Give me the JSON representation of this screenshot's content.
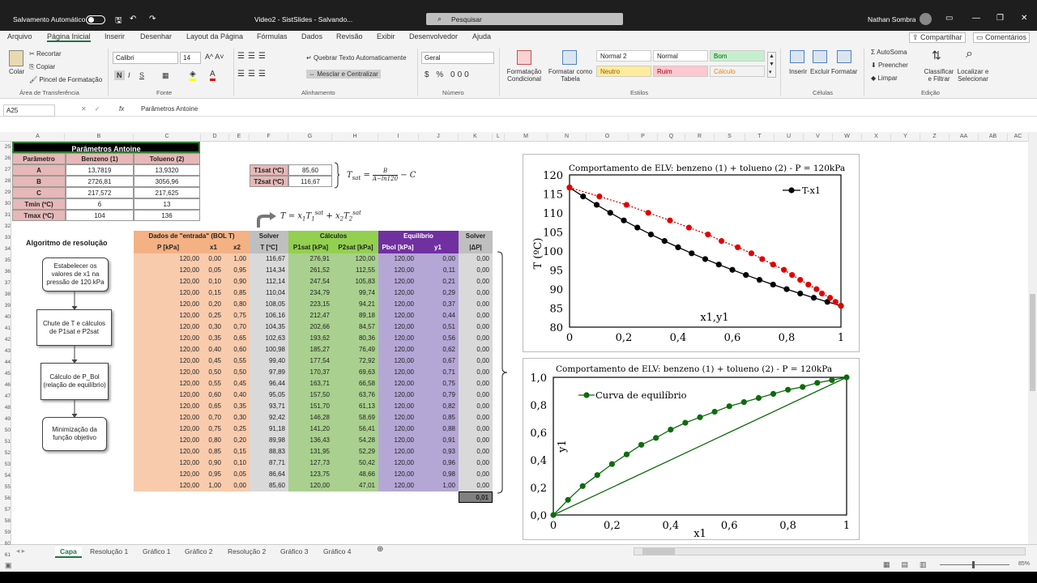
{
  "titlebar": {
    "autosave": "Salvamento Automático",
    "doc": "Video2 - SistSlides - Salvando...",
    "search": "Pesquisar",
    "user": "Nathan Sombra"
  },
  "menu": [
    "Arquivo",
    "Página Inicial",
    "Inserir",
    "Desenhar",
    "Layout da Página",
    "Fórmulas",
    "Dados",
    "Revisão",
    "Exibir",
    "Desenvolvedor",
    "Ajuda"
  ],
  "share": "Compartilhar",
  "comments": "Comentários",
  "ribbon": {
    "colar": "Colar",
    "recortar": "Recortar",
    "copiar": "Copiar",
    "pincel": "Pincel de Formatação",
    "area": "Área de Transferência",
    "font": "Calibri",
    "size": "14",
    "fonte": "Fonte",
    "wrap": "Quebrar Texto Automaticamente",
    "merge": "Mesclar e Centralizar",
    "alinhamento": "Alinhamento",
    "numfmt": "Geral",
    "numero": "Número",
    "cond": "Formatação Condicional",
    "tabela": "Formatar como Tabela",
    "estilos": "Estilos",
    "inserir": "Inserir",
    "excluir": "Excluir",
    "formatar": "Formatar",
    "celulas": "Células",
    "autosoma": "AutoSoma",
    "preencher": "Preencher",
    "limpar": "Limpar",
    "classificar": "Classificar e Filtrar",
    "localizar": "Localizar e Selecionar",
    "edicao": "Edição",
    "styles": [
      {
        "name": "Normal 2",
        "bg": "#ffffff",
        "fg": "#222222"
      },
      {
        "name": "Normal",
        "bg": "#ffffff",
        "fg": "#222222"
      },
      {
        "name": "Bom",
        "bg": "#c6efce",
        "fg": "#006100"
      },
      {
        "name": "Neutro",
        "bg": "#ffeb9c",
        "fg": "#9c5700"
      },
      {
        "name": "Ruim",
        "bg": "#ffc7ce",
        "fg": "#9c0006"
      },
      {
        "name": "Cálculo",
        "bg": "#f2f2f2",
        "fg": "#fa7d00"
      }
    ]
  },
  "formula": {
    "namebox": "A25",
    "fx": "fx",
    "content": "Parâmetros Antoine"
  },
  "columns": [
    "A",
    "B",
    "C",
    "D",
    "E",
    "F",
    "G",
    "H",
    "I",
    "J",
    "K",
    "L",
    "M",
    "N",
    "O",
    "P",
    "Q",
    "R",
    "S",
    "T",
    "U",
    "V",
    "W",
    "X",
    "Y",
    "Z",
    "AA",
    "AB",
    "AC"
  ],
  "rows": [
    "25",
    "26",
    "27",
    "28",
    "29",
    "30",
    "31",
    "32",
    "33",
    "34",
    "35",
    "36",
    "37",
    "38",
    "39",
    "40",
    "41",
    "42",
    "43",
    "44",
    "45",
    "46",
    "47",
    "48",
    "49",
    "50",
    "51",
    "52",
    "53",
    "54",
    "55",
    "56",
    "57",
    "58",
    "59",
    "60",
    "61"
  ],
  "antoine": {
    "title": "Parâmetros Antoine",
    "headers": [
      "Parâmetro",
      "Benzeno (1)",
      "Tolueno (2)"
    ],
    "rows": [
      [
        "A",
        "13,7819",
        "13,9320"
      ],
      [
        "B",
        "2726,81",
        "3056,96"
      ],
      [
        "C",
        "217,572",
        "217,625"
      ],
      [
        "Tmin (ºC)",
        "6",
        "13"
      ],
      [
        "Tmax (ºC)",
        "104",
        "136"
      ]
    ]
  },
  "tsat": {
    "rows": [
      [
        "T1sat (ºC)",
        "85,60"
      ],
      [
        "T2sat (ºC)",
        "116,67"
      ]
    ]
  },
  "algo": {
    "title": "Algoritmo de resolução",
    "steps": [
      "Estabelecer os valores de x1 na pressão de 120 kPa",
      "Chute de T e cálculos de P1sat e P2sat",
      "Cálculo de P_Bol (relação de equilíbrio)",
      "Minimização da função objetivo"
    ]
  },
  "table": {
    "groups": [
      "Dados de \"entrada\" (BOL T)",
      "Solver",
      "Cálculos",
      "Equilíbrio",
      "Solver"
    ],
    "headers": [
      "P [kPa]",
      "x1",
      "x2",
      "T [ºC]",
      "P1sat [kPa]",
      "P2sat [kPa]",
      "Pbol [kPa]",
      "y1",
      "|ΔP|"
    ],
    "rows": [
      [
        "120,00",
        "0,00",
        "1,00",
        "116,67",
        "276,91",
        "120,00",
        "120,00",
        "0,00",
        "0,00"
      ],
      [
        "120,00",
        "0,05",
        "0,95",
        "114,34",
        "261,52",
        "112,55",
        "120,00",
        "0,11",
        "0,00"
      ],
      [
        "120,00",
        "0,10",
        "0,90",
        "112,14",
        "247,54",
        "105,83",
        "120,00",
        "0,21",
        "0,00"
      ],
      [
        "120,00",
        "0,15",
        "0,85",
        "110,04",
        "234,79",
        "99,74",
        "120,00",
        "0,29",
        "0,00"
      ],
      [
        "120,00",
        "0,20",
        "0,80",
        "108,05",
        "223,15",
        "94,21",
        "120,00",
        "0,37",
        "0,00"
      ],
      [
        "120,00",
        "0,25",
        "0,75",
        "106,16",
        "212,47",
        "89,18",
        "120,00",
        "0,44",
        "0,00"
      ],
      [
        "120,00",
        "0,30",
        "0,70",
        "104,35",
        "202,66",
        "84,57",
        "120,00",
        "0,51",
        "0,00"
      ],
      [
        "120,00",
        "0,35",
        "0,65",
        "102,63",
        "193,62",
        "80,36",
        "120,00",
        "0,56",
        "0,00"
      ],
      [
        "120,00",
        "0,40",
        "0,60",
        "100,98",
        "185,27",
        "76,49",
        "120,00",
        "0,62",
        "0,00"
      ],
      [
        "120,00",
        "0,45",
        "0,55",
        "99,40",
        "177,54",
        "72,92",
        "120,00",
        "0,67",
        "0,00"
      ],
      [
        "120,00",
        "0,50",
        "0,50",
        "97,89",
        "170,37",
        "69,63",
        "120,00",
        "0,71",
        "0,00"
      ],
      [
        "120,00",
        "0,55",
        "0,45",
        "96,44",
        "163,71",
        "66,58",
        "120,00",
        "0,75",
        "0,00"
      ],
      [
        "120,00",
        "0,60",
        "0,40",
        "95,05",
        "157,50",
        "63,76",
        "120,00",
        "0,79",
        "0,00"
      ],
      [
        "120,00",
        "0,65",
        "0,35",
        "93,71",
        "151,70",
        "61,13",
        "120,00",
        "0,82",
        "0,00"
      ],
      [
        "120,00",
        "0,70",
        "0,30",
        "92,42",
        "146,28",
        "58,69",
        "120,00",
        "0,85",
        "0,00"
      ],
      [
        "120,00",
        "0,75",
        "0,25",
        "91,18",
        "141,20",
        "56,41",
        "120,00",
        "0,88",
        "0,00"
      ],
      [
        "120,00",
        "0,80",
        "0,20",
        "89,98",
        "136,43",
        "54,28",
        "120,00",
        "0,91",
        "0,00"
      ],
      [
        "120,00",
        "0,85",
        "0,15",
        "88,83",
        "131,95",
        "52,29",
        "120,00",
        "0,93",
        "0,00"
      ],
      [
        "120,00",
        "0,90",
        "0,10",
        "87,71",
        "127,73",
        "50,42",
        "120,00",
        "0,96",
        "0,00"
      ],
      [
        "120,00",
        "0,95",
        "0,05",
        "86,64",
        "123,75",
        "48,66",
        "120,00",
        "0,98",
        "0,00"
      ],
      [
        "120,00",
        "1,00",
        "0,00",
        "85,60",
        "120,00",
        "47,01",
        "120,00",
        "1,00",
        "0,00"
      ]
    ],
    "total": "0,01"
  },
  "tabs": [
    "Capa",
    "Resolução 1",
    "Gráfico 1",
    "Gráfico 2",
    "Resolução 2",
    "Gráfico 3",
    "Gráfico 4"
  ],
  "zoom": "85%",
  "chart_data": [
    {
      "type": "line",
      "title": "Comportamento de ELV: benzeno (1) + tolueno (2) - P =  120kPa",
      "xlabel": "x1,y1",
      "ylabel": "T (ºC)",
      "xlim": [
        0,
        1
      ],
      "ylim": [
        80,
        120
      ],
      "xticks": [
        "0",
        "0,2",
        "0,4",
        "0,6",
        "0,8",
        "1"
      ],
      "yticks": [
        "80",
        "85",
        "90",
        "95",
        "100",
        "105",
        "110",
        "115",
        "120"
      ],
      "legend": "T-x1",
      "series": [
        {
          "name": "T-x1",
          "color": "#000000",
          "x": [
            0,
            0.05,
            0.1,
            0.15,
            0.2,
            0.25,
            0.3,
            0.35,
            0.4,
            0.45,
            0.5,
            0.55,
            0.6,
            0.65,
            0.7,
            0.75,
            0.8,
            0.85,
            0.9,
            0.95,
            1
          ],
          "y": [
            116.67,
            114.34,
            112.14,
            110.04,
            108.05,
            106.16,
            104.35,
            102.63,
            100.98,
            99.4,
            97.89,
            96.44,
            95.05,
            93.71,
            92.42,
            91.18,
            89.98,
            88.83,
            87.71,
            86.64,
            85.6
          ]
        },
        {
          "color": "#e00000",
          "x": [
            0,
            0.11,
            0.21,
            0.29,
            0.37,
            0.44,
            0.51,
            0.56,
            0.62,
            0.67,
            0.71,
            0.75,
            0.79,
            0.82,
            0.85,
            0.88,
            0.91,
            0.93,
            0.96,
            0.98,
            1
          ],
          "y": [
            116.67,
            114.34,
            112.14,
            110.04,
            108.05,
            106.16,
            104.35,
            102.63,
            100.98,
            99.4,
            97.89,
            96.44,
            95.05,
            93.71,
            92.42,
            91.18,
            89.98,
            88.83,
            87.71,
            86.64,
            85.6
          ]
        }
      ]
    },
    {
      "type": "line",
      "title": "Comportamento de ELV: benzeno (1) + tolueno (2) - P =  120kPa",
      "xlabel": "x1",
      "ylabel": "y1",
      "xlim": [
        0,
        1
      ],
      "ylim": [
        0,
        1
      ],
      "xticks": [
        "0",
        "0,2",
        "0,4",
        "0,6",
        "0,8",
        "1"
      ],
      "yticks": [
        "0,0",
        "0,2",
        "0,4",
        "0,6",
        "0,8",
        "1,0"
      ],
      "legend": "Curva de equilíbrio",
      "series": [
        {
          "name": "Curva de equilíbrio",
          "color": "#0e6b0e",
          "x": [
            0,
            0.05,
            0.1,
            0.15,
            0.2,
            0.25,
            0.3,
            0.35,
            0.4,
            0.45,
            0.5,
            0.55,
            0.6,
            0.65,
            0.7,
            0.75,
            0.8,
            0.85,
            0.9,
            0.95,
            1
          ],
          "y": [
            0,
            0.11,
            0.21,
            0.29,
            0.37,
            0.44,
            0.51,
            0.56,
            0.62,
            0.67,
            0.71,
            0.75,
            0.79,
            0.82,
            0.85,
            0.88,
            0.91,
            0.93,
            0.96,
            0.98,
            1
          ]
        }
      ]
    }
  ]
}
